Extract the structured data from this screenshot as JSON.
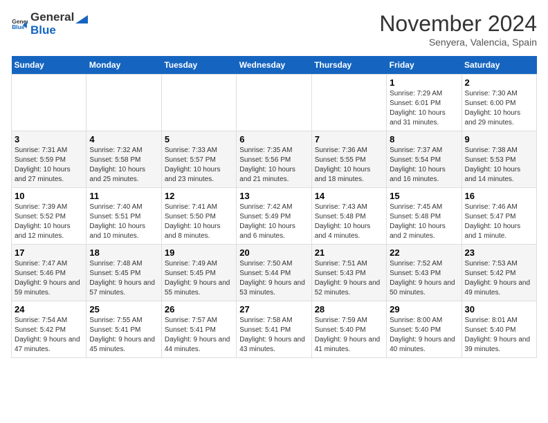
{
  "header": {
    "logo_general": "General",
    "logo_blue": "Blue",
    "month_title": "November 2024",
    "location": "Senyera, Valencia, Spain"
  },
  "weekdays": [
    "Sunday",
    "Monday",
    "Tuesday",
    "Wednesday",
    "Thursday",
    "Friday",
    "Saturday"
  ],
  "weeks": [
    [
      {
        "day": "",
        "info": ""
      },
      {
        "day": "",
        "info": ""
      },
      {
        "day": "",
        "info": ""
      },
      {
        "day": "",
        "info": ""
      },
      {
        "day": "",
        "info": ""
      },
      {
        "day": "1",
        "info": "Sunrise: 7:29 AM\nSunset: 6:01 PM\nDaylight: 10 hours and 31 minutes."
      },
      {
        "day": "2",
        "info": "Sunrise: 7:30 AM\nSunset: 6:00 PM\nDaylight: 10 hours and 29 minutes."
      }
    ],
    [
      {
        "day": "3",
        "info": "Sunrise: 7:31 AM\nSunset: 5:59 PM\nDaylight: 10 hours and 27 minutes."
      },
      {
        "day": "4",
        "info": "Sunrise: 7:32 AM\nSunset: 5:58 PM\nDaylight: 10 hours and 25 minutes."
      },
      {
        "day": "5",
        "info": "Sunrise: 7:33 AM\nSunset: 5:57 PM\nDaylight: 10 hours and 23 minutes."
      },
      {
        "day": "6",
        "info": "Sunrise: 7:35 AM\nSunset: 5:56 PM\nDaylight: 10 hours and 21 minutes."
      },
      {
        "day": "7",
        "info": "Sunrise: 7:36 AM\nSunset: 5:55 PM\nDaylight: 10 hours and 18 minutes."
      },
      {
        "day": "8",
        "info": "Sunrise: 7:37 AM\nSunset: 5:54 PM\nDaylight: 10 hours and 16 minutes."
      },
      {
        "day": "9",
        "info": "Sunrise: 7:38 AM\nSunset: 5:53 PM\nDaylight: 10 hours and 14 minutes."
      }
    ],
    [
      {
        "day": "10",
        "info": "Sunrise: 7:39 AM\nSunset: 5:52 PM\nDaylight: 10 hours and 12 minutes."
      },
      {
        "day": "11",
        "info": "Sunrise: 7:40 AM\nSunset: 5:51 PM\nDaylight: 10 hours and 10 minutes."
      },
      {
        "day": "12",
        "info": "Sunrise: 7:41 AM\nSunset: 5:50 PM\nDaylight: 10 hours and 8 minutes."
      },
      {
        "day": "13",
        "info": "Sunrise: 7:42 AM\nSunset: 5:49 PM\nDaylight: 10 hours and 6 minutes."
      },
      {
        "day": "14",
        "info": "Sunrise: 7:43 AM\nSunset: 5:48 PM\nDaylight: 10 hours and 4 minutes."
      },
      {
        "day": "15",
        "info": "Sunrise: 7:45 AM\nSunset: 5:48 PM\nDaylight: 10 hours and 2 minutes."
      },
      {
        "day": "16",
        "info": "Sunrise: 7:46 AM\nSunset: 5:47 PM\nDaylight: 10 hours and 1 minute."
      }
    ],
    [
      {
        "day": "17",
        "info": "Sunrise: 7:47 AM\nSunset: 5:46 PM\nDaylight: 9 hours and 59 minutes."
      },
      {
        "day": "18",
        "info": "Sunrise: 7:48 AM\nSunset: 5:45 PM\nDaylight: 9 hours and 57 minutes."
      },
      {
        "day": "19",
        "info": "Sunrise: 7:49 AM\nSunset: 5:45 PM\nDaylight: 9 hours and 55 minutes."
      },
      {
        "day": "20",
        "info": "Sunrise: 7:50 AM\nSunset: 5:44 PM\nDaylight: 9 hours and 53 minutes."
      },
      {
        "day": "21",
        "info": "Sunrise: 7:51 AM\nSunset: 5:43 PM\nDaylight: 9 hours and 52 minutes."
      },
      {
        "day": "22",
        "info": "Sunrise: 7:52 AM\nSunset: 5:43 PM\nDaylight: 9 hours and 50 minutes."
      },
      {
        "day": "23",
        "info": "Sunrise: 7:53 AM\nSunset: 5:42 PM\nDaylight: 9 hours and 49 minutes."
      }
    ],
    [
      {
        "day": "24",
        "info": "Sunrise: 7:54 AM\nSunset: 5:42 PM\nDaylight: 9 hours and 47 minutes."
      },
      {
        "day": "25",
        "info": "Sunrise: 7:55 AM\nSunset: 5:41 PM\nDaylight: 9 hours and 45 minutes."
      },
      {
        "day": "26",
        "info": "Sunrise: 7:57 AM\nSunset: 5:41 PM\nDaylight: 9 hours and 44 minutes."
      },
      {
        "day": "27",
        "info": "Sunrise: 7:58 AM\nSunset: 5:41 PM\nDaylight: 9 hours and 43 minutes."
      },
      {
        "day": "28",
        "info": "Sunrise: 7:59 AM\nSunset: 5:40 PM\nDaylight: 9 hours and 41 minutes."
      },
      {
        "day": "29",
        "info": "Sunrise: 8:00 AM\nSunset: 5:40 PM\nDaylight: 9 hours and 40 minutes."
      },
      {
        "day": "30",
        "info": "Sunrise: 8:01 AM\nSunset: 5:40 PM\nDaylight: 9 hours and 39 minutes."
      }
    ]
  ]
}
